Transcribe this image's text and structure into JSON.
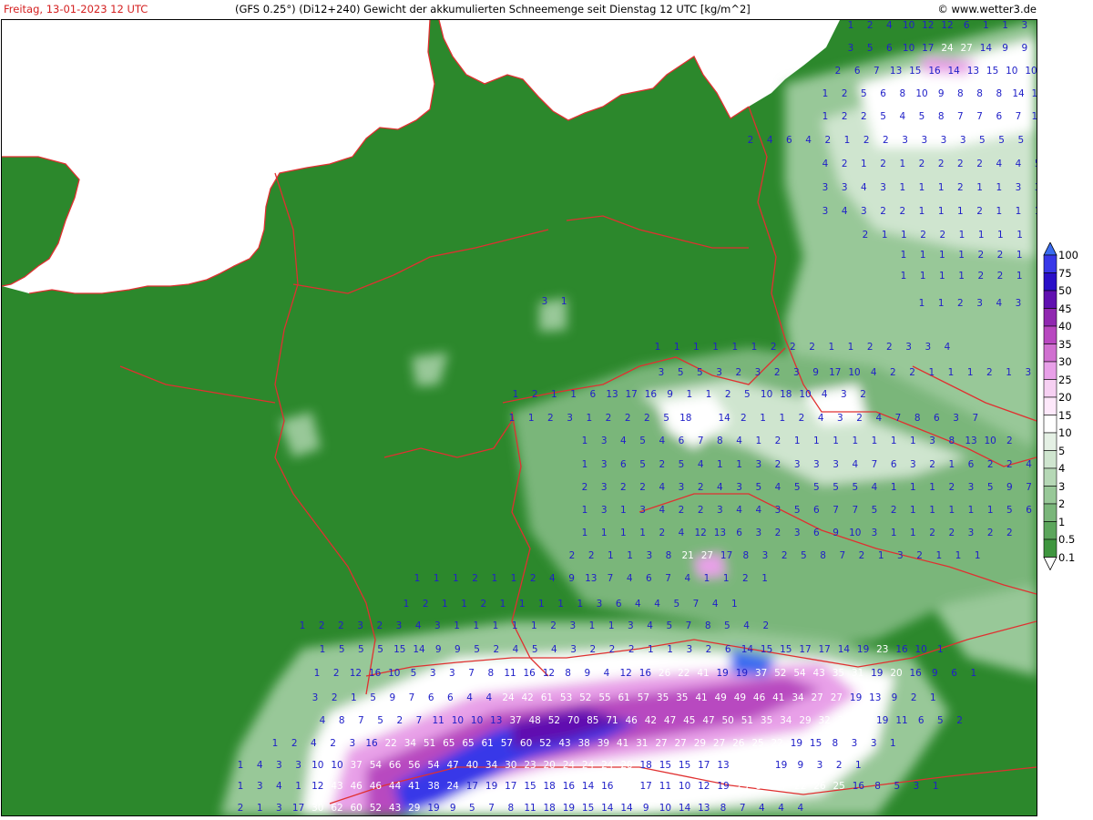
{
  "header": {
    "date_text": "Freitag, 13-01-2023 12 UTC",
    "title_text": "(GFS 0.25°) (Di12+240) Gewicht der akkumulierten Schneemenge seit Dienstag 12 UTC [kg/m^2]",
    "copyright_text": "© www.wetter3.de"
  },
  "colors": {
    "sea": "#ffffff",
    "land_base": "#2c882c",
    "borders": "#e03030",
    "number_text": "#2020c8",
    "date_text": "#d42020"
  },
  "legend": {
    "levels": [
      "100",
      "75",
      "50",
      "45",
      "40",
      "35",
      "30",
      "25",
      "20",
      "15",
      "10",
      "5",
      "4",
      "3",
      "2",
      "1",
      "0.5",
      "0.1"
    ],
    "colors": [
      "#3a6cf0",
      "#3838e8",
      "#2a10c8",
      "#6010b0",
      "#9028b0",
      "#b848c0",
      "#d070d0",
      "#e8a0e8",
      "#f6d0f2",
      "#fde8fa",
      "#ffffff",
      "#e4f0e4",
      "#cfe5cf",
      "#b6d8b6",
      "#98c898",
      "#7ab67a",
      "#5ca65c",
      "#3f963f"
    ]
  },
  "map": {
    "value_labels": [
      "1",
      "2",
      "4",
      "10",
      "12",
      "12",
      "6",
      "1",
      "1",
      "3",
      "4",
      "3",
      "5",
      "6",
      "10",
      "17",
      "24",
      "27",
      "14",
      "9",
      "9",
      "9",
      "2",
      "6",
      "7",
      "13",
      "15",
      "16",
      "14",
      "13",
      "15",
      "10",
      "10",
      "10",
      "1",
      "2",
      "5",
      "6",
      "8",
      "10",
      "9",
      "8",
      "8",
      "8",
      "14",
      "13",
      "12",
      "1",
      "2",
      "2",
      "5",
      "4",
      "5",
      "8",
      "7",
      "7",
      "6",
      "7",
      "10",
      "10",
      "2",
      "4",
      "6",
      "4",
      "2",
      "1",
      "2",
      "2",
      "3",
      "3",
      "3",
      "3",
      "5",
      "5",
      "5",
      "6",
      "7",
      "8",
      "4",
      "2",
      "1",
      "2",
      "1",
      "2",
      "2",
      "2",
      "2",
      "4",
      "4",
      "5",
      "6",
      "3",
      "3",
      "4",
      "3",
      "1",
      "1",
      "1",
      "2",
      "1",
      "1",
      "3",
      "3",
      "3",
      "3",
      "4",
      "3",
      "2",
      "2",
      "1",
      "1",
      "1",
      "2",
      "1",
      "1",
      "1",
      "2",
      "2",
      "1",
      "1",
      "2",
      "2",
      "1",
      "1",
      "1",
      "1",
      "1",
      "1",
      "1",
      "1",
      "1",
      "1",
      "1",
      "2",
      "2",
      "1",
      "1",
      "1",
      "1",
      "3",
      "1",
      "1",
      "1",
      "1",
      "1",
      "2",
      "2",
      "1",
      "1",
      "1",
      "1",
      "1",
      "1",
      "2",
      "3",
      "4",
      "3",
      "1",
      "1",
      "1",
      "1",
      "1",
      "1",
      "2",
      "2",
      "2",
      "1",
      "1",
      "2",
      "2",
      "3",
      "3",
      "4",
      "3",
      "5",
      "5",
      "3",
      "2",
      "3",
      "2",
      "3",
      "9",
      "17",
      "10",
      "4",
      "2",
      "2",
      "1",
      "1",
      "1",
      "2",
      "1",
      "3",
      "4",
      "1",
      "2",
      "1",
      "1",
      "6",
      "13",
      "17",
      "16",
      "9",
      "1",
      "1",
      "2",
      "5",
      "10",
      "18",
      "10",
      "4",
      "3",
      "2",
      "1",
      "1",
      "2",
      "3",
      "1",
      "2",
      "2",
      "2",
      "5",
      "18",
      "21",
      "14",
      "2",
      "1",
      "1",
      "2",
      "4",
      "3",
      "2",
      "4",
      "7",
      "8",
      "6",
      "3",
      "7",
      "1",
      "3",
      "4",
      "5",
      "4",
      "6",
      "7",
      "8",
      "4",
      "1",
      "2",
      "1",
      "1",
      "1",
      "1",
      "1",
      "1",
      "1",
      "3",
      "8",
      "13",
      "10",
      "2",
      "1",
      "3",
      "6",
      "5",
      "2",
      "5",
      "4",
      "1",
      "1",
      "3",
      "2",
      "3",
      "3",
      "3",
      "4",
      "7",
      "6",
      "3",
      "2",
      "1",
      "6",
      "2",
      "2",
      "4",
      "5",
      "2",
      "3",
      "2",
      "2",
      "4",
      "3",
      "2",
      "4",
      "3",
      "5",
      "4",
      "5",
      "5",
      "5",
      "5",
      "4",
      "1",
      "1",
      "1",
      "2",
      "3",
      "5",
      "9",
      "7",
      "1",
      "3",
      "1",
      "3",
      "4",
      "2",
      "2",
      "3",
      "4",
      "4",
      "3",
      "5",
      "6",
      "7",
      "7",
      "5",
      "2",
      "1",
      "1",
      "1",
      "1",
      "1",
      "5",
      "6",
      "1",
      "1",
      "1",
      "1",
      "2",
      "4",
      "12",
      "13",
      "6",
      "3",
      "2",
      "3",
      "6",
      "9",
      "10",
      "3",
      "1",
      "1",
      "2",
      "2",
      "3",
      "2",
      "2",
      "2",
      "2",
      "1",
      "1",
      "3",
      "8",
      "21",
      "27",
      "17",
      "8",
      "3",
      "2",
      "5",
      "8",
      "7",
      "2",
      "1",
      "3",
      "2",
      "1",
      "1",
      "1",
      "1",
      "1",
      "1",
      "2",
      "1",
      "1",
      "2",
      "4",
      "9",
      "13",
      "7",
      "4",
      "6",
      "7",
      "4",
      "1",
      "1",
      "2",
      "1",
      "1",
      "2",
      "1",
      "1",
      "2",
      "1",
      "1",
      "1",
      "1",
      "1",
      "3",
      "6",
      "4",
      "4",
      "5",
      "7",
      "4",
      "1",
      "1",
      "2",
      "2",
      "3",
      "2",
      "3",
      "4",
      "3",
      "1",
      "1",
      "1",
      "1",
      "1",
      "2",
      "3",
      "1",
      "1",
      "3",
      "4",
      "5",
      "7",
      "8",
      "5",
      "4",
      "2",
      "1",
      "5",
      "5",
      "5",
      "15",
      "14",
      "9",
      "9",
      "5",
      "2",
      "4",
      "5",
      "4",
      "3",
      "2",
      "2",
      "2",
      "1",
      "1",
      "3",
      "2",
      "6",
      "14",
      "15",
      "15",
      "17",
      "17",
      "14",
      "19",
      "23",
      "16",
      "10",
      "1",
      "1",
      "2",
      "12",
      "16",
      "10",
      "5",
      "3",
      "3",
      "7",
      "8",
      "11",
      "16",
      "12",
      "8",
      "9",
      "4",
      "12",
      "16",
      "26",
      "22",
      "41",
      "19",
      "19",
      "37",
      "52",
      "54",
      "43",
      "35",
      "31",
      "19",
      "20",
      "16",
      "9",
      "6",
      "1",
      "3",
      "2",
      "1",
      "5",
      "9",
      "7",
      "6",
      "6",
      "4",
      "4",
      "24",
      "42",
      "61",
      "53",
      "52",
      "55",
      "61",
      "57",
      "35",
      "35",
      "41",
      "49",
      "49",
      "46",
      "41",
      "34",
      "27",
      "27",
      "19",
      "13",
      "9",
      "2",
      "1",
      "4",
      "8",
      "7",
      "5",
      "2",
      "7",
      "11",
      "10",
      "10",
      "13",
      "37",
      "48",
      "52",
      "70",
      "85",
      "71",
      "46",
      "42",
      "47",
      "45",
      "47",
      "50",
      "51",
      "35",
      "34",
      "29",
      "32",
      "31",
      "24",
      "19",
      "11",
      "6",
      "5",
      "2",
      "1",
      "2",
      "4",
      "2",
      "3",
      "16",
      "22",
      "34",
      "51",
      "65",
      "65",
      "61",
      "57",
      "60",
      "52",
      "43",
      "38",
      "39",
      "41",
      "31",
      "27",
      "27",
      "29",
      "27",
      "26",
      "25",
      "22",
      "19",
      "15",
      "8",
      "3",
      "3",
      "1",
      "1",
      "4",
      "3",
      "3",
      "10",
      "10",
      "37",
      "54",
      "66",
      "56",
      "54",
      "47",
      "40",
      "34",
      "30",
      "23",
      "20",
      "24",
      "24",
      "24",
      "20",
      "18",
      "15",
      "15",
      "17",
      "13",
      "25",
      "24",
      "19",
      "9",
      "3",
      "2",
      "1",
      "1",
      "3",
      "4",
      "1",
      "12",
      "43",
      "46",
      "46",
      "44",
      "41",
      "38",
      "24",
      "17",
      "19",
      "17",
      "15",
      "18",
      "16",
      "14",
      "16",
      "21",
      "17",
      "11",
      "10",
      "12",
      "19",
      "23",
      "30",
      "27",
      "22",
      "26",
      "25",
      "16",
      "8",
      "5",
      "3",
      "1",
      "2",
      "1",
      "3",
      "17",
      "30",
      "62",
      "60",
      "52",
      "43",
      "29",
      "19",
      "9",
      "5",
      "7",
      "8",
      "11",
      "18",
      "19",
      "15",
      "14",
      "14",
      "9",
      "10",
      "14",
      "13",
      "8",
      "7",
      "4",
      "4",
      "4"
    ]
  }
}
